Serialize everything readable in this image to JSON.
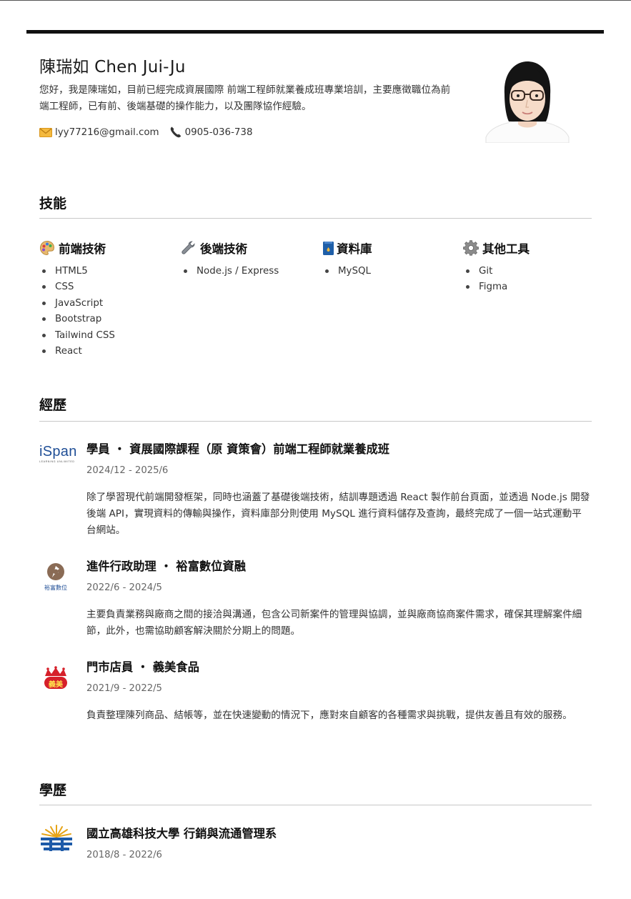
{
  "header": {
    "name": "陳瑞如 Chen Jui-Ju",
    "intro": "您好，我是陳瑞如，目前已經完成資展國際 前端工程師就業養成班專業培訓，主要應徵職位為前端工程師，已有前、後端基礎的操作能力，以及團隊協作經驗。",
    "email": "lyy77216@gmail.com",
    "phone": "0905-036-738",
    "email_icon": "envelope-icon",
    "phone_icon": "phone-icon"
  },
  "skills": {
    "title": "技能",
    "groups": [
      {
        "icon": "palette-icon",
        "title": "前端技術",
        "items": [
          "HTML5",
          "CSS",
          "JavaScript",
          "Bootstrap",
          "Tailwind CSS",
          "React"
        ]
      },
      {
        "icon": "wrench-icon",
        "title": "後端技術",
        "items": [
          "Node.js / Express"
        ]
      },
      {
        "icon": "database-icon",
        "title": "資料庫",
        "items": [
          "MySQL"
        ]
      },
      {
        "icon": "gear-icon",
        "title": "其他工具",
        "items": [
          "Git",
          "Figma"
        ]
      }
    ]
  },
  "experience": {
    "title": "經歷",
    "items": [
      {
        "logo": "ispan-logo",
        "logo_text": "iSpan",
        "logo_subtext": "LEARNING UNLIMITED",
        "title": "學員 ・ 資展國際課程（原 資策會）前端工程師就業養成班",
        "date": "2024/12 - 2025/6",
        "desc": "除了學習現代前端開發框架，同時也涵蓋了基礎後端技術，結訓專題透過 React 製作前台頁面，並透過 Node.js 開發後端 API，實現資料的傳輸與操作，資料庫部分則使用 MySQL 進行資料儲存及查詢，最終完成了一個一站式運動平台網站。"
      },
      {
        "logo": "yufu-logo",
        "logo_text": "裕富數位",
        "title": "進件行政助理 ・ 裕富數位資融",
        "date": "2022/6 - 2024/5",
        "desc": "主要負責業務與廠商之間的接洽與溝通，包含公司新案件的管理與協調，並與廠商協商案件需求，確保其理解案件細節，此外，也需協助顧客解決關於分期上的問題。"
      },
      {
        "logo": "imei-logo",
        "logo_text": "義美",
        "title": "門市店員 ・ 義美食品",
        "date": "2021/9 - 2022/5",
        "desc": "負責整理陳列商品、結帳等，並在快速變動的情況下，應對來自顧客的各種需求與挑戰，提供友善且有效的服務。"
      }
    ]
  },
  "education": {
    "title": "學歷",
    "items": [
      {
        "logo": "nkust-logo",
        "title": "國立高雄科技大學 行銷與流通管理系",
        "date": "2018/8 - 2022/6"
      }
    ]
  },
  "colors": {
    "rule": "#c8c8c8",
    "ispan_blue": "#1f4e96",
    "yufu_brown": "#7a5c46",
    "imei_red": "#d6202a",
    "nkust_blue": "#1d5aa8",
    "nkust_gold": "#e6a417"
  }
}
